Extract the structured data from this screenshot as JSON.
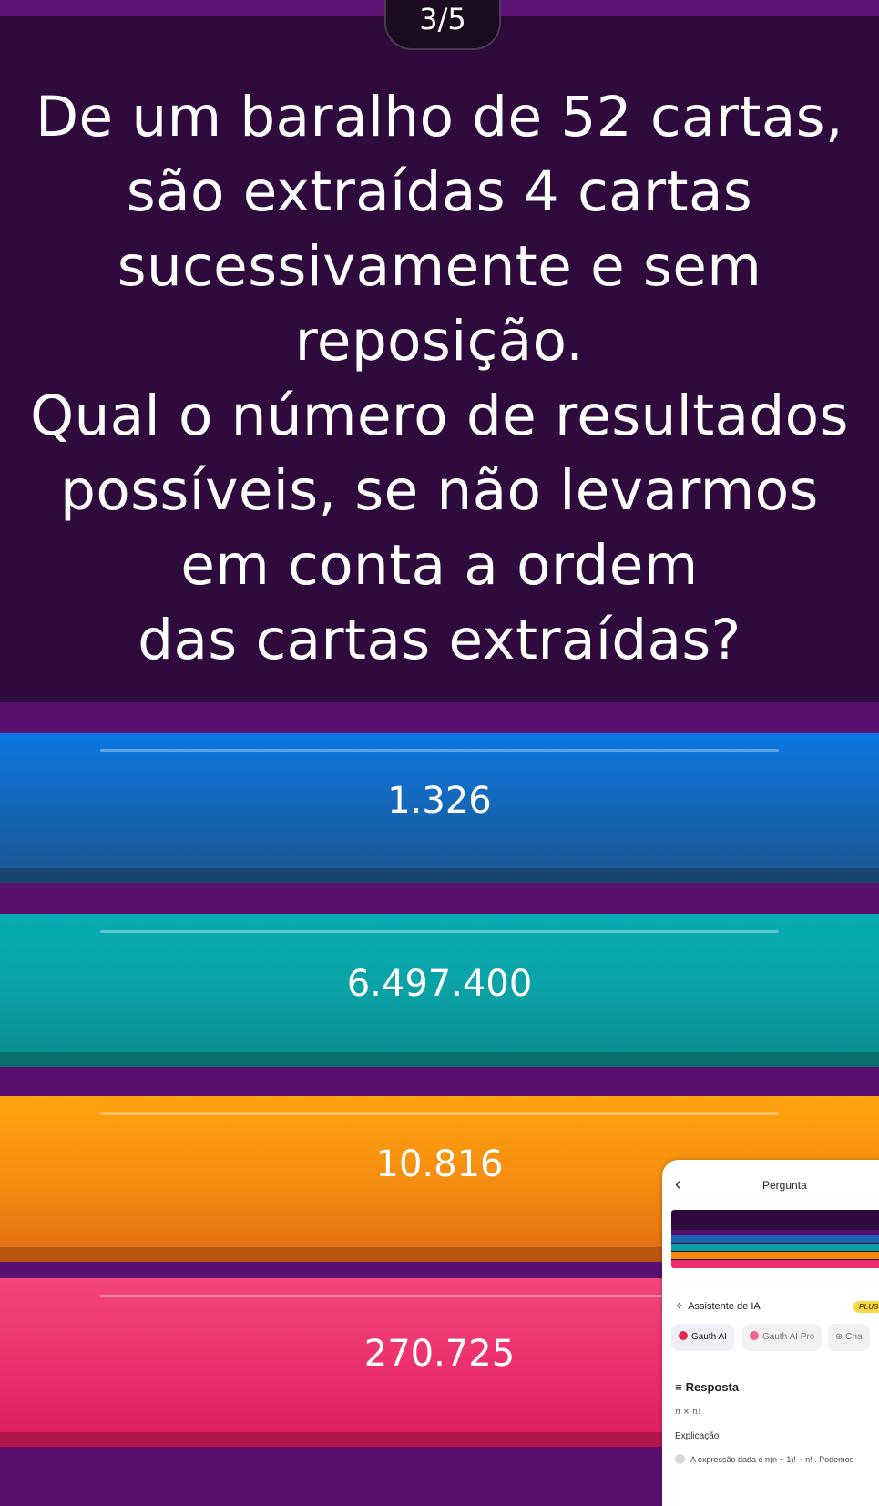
{
  "quiz": {
    "progress": "3/5",
    "question_lines": [
      "De um baralho de 52 cartas,",
      "são extraídas 4 cartas",
      "sucessivamente e sem",
      "reposição.",
      "Qual o número de resultados",
      "possíveis, se não levarmos",
      "em conta a ordem",
      "das cartas extraídas?"
    ],
    "options": [
      {
        "label": "1.326",
        "color": "#1565b3"
      },
      {
        "label": "6.497.400",
        "color": "#0aa0a3"
      },
      {
        "label": "10.816",
        "color": "#f48b10"
      },
      {
        "label": "270.725",
        "color": "#eb2f6c"
      }
    ],
    "colors": {
      "background": "#5b1070",
      "question_panel": "#2e0b3c"
    }
  },
  "overlay": {
    "back_icon": "chevron-left-icon",
    "title": "Pergunta",
    "assistant_label": "Assistente de IA",
    "plus_badge": "PLUS",
    "chips": [
      "Gauth AI",
      "Gauth AI Pro",
      "Cha"
    ],
    "answer_heading": "Resposta",
    "answer_formula": "n × n!",
    "explanation_heading": "Explicação",
    "explanation_text": "A expressão dada é  n(n + 1)! − n! . Podemos"
  }
}
